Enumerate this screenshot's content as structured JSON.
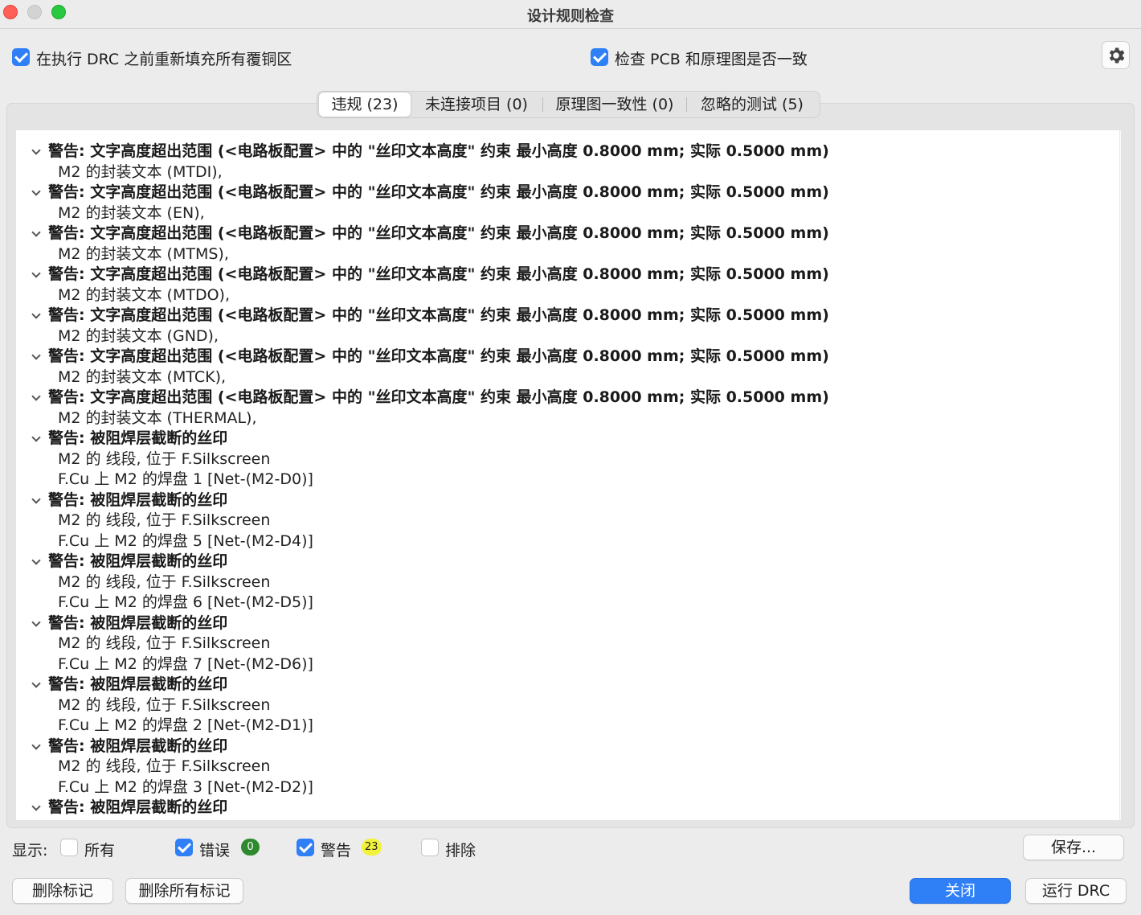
{
  "window": {
    "title": "设计规则检查"
  },
  "options": {
    "refill_zones": {
      "label": "在执行 DRC 之前重新填充所有覆铜区",
      "checked": true
    },
    "check_parity": {
      "label": "检查 PCB 和原理图是否一致",
      "checked": true
    }
  },
  "tabs": [
    {
      "label": "违规 (23)",
      "active": true
    },
    {
      "label": "未连接项目 (0)",
      "active": false
    },
    {
      "label": "原理图一致性 (0)",
      "active": false
    },
    {
      "label": "忽略的测试 (5)",
      "active": false
    }
  ],
  "violations": [
    {
      "title": "警告: 文字高度超出范围 (<电路板配置> 中的 \"丝印文本高度\" 约束 最小高度 0.8000 mm; 实际 0.5000 mm)",
      "items": [
        "M2 的封装文本 (MTDI),"
      ]
    },
    {
      "title": "警告: 文字高度超出范围 (<电路板配置> 中的 \"丝印文本高度\" 约束 最小高度 0.8000 mm; 实际 0.5000 mm)",
      "items": [
        "M2 的封装文本 (EN),"
      ]
    },
    {
      "title": "警告: 文字高度超出范围 (<电路板配置> 中的 \"丝印文本高度\" 约束 最小高度 0.8000 mm; 实际 0.5000 mm)",
      "items": [
        "M2 的封装文本 (MTMS),"
      ]
    },
    {
      "title": "警告: 文字高度超出范围 (<电路板配置> 中的 \"丝印文本高度\" 约束 最小高度 0.8000 mm; 实际 0.5000 mm)",
      "items": [
        "M2 的封装文本 (MTDO),"
      ]
    },
    {
      "title": "警告: 文字高度超出范围 (<电路板配置> 中的 \"丝印文本高度\" 约束 最小高度 0.8000 mm; 实际 0.5000 mm)",
      "items": [
        "M2 的封装文本 (GND),"
      ]
    },
    {
      "title": "警告: 文字高度超出范围 (<电路板配置> 中的 \"丝印文本高度\" 约束 最小高度 0.8000 mm; 实际 0.5000 mm)",
      "items": [
        "M2 的封装文本 (MTCK),"
      ]
    },
    {
      "title": "警告: 文字高度超出范围 (<电路板配置> 中的 \"丝印文本高度\" 约束 最小高度 0.8000 mm; 实际 0.5000 mm)",
      "items": [
        "M2 的封装文本 (THERMAL),"
      ]
    },
    {
      "title": "警告: 被阻焊层截断的丝印",
      "items": [
        "M2 的 线段, 位于 F.Silkscreen",
        "F.Cu 上 M2 的焊盘 1 [Net-(M2-D0)]"
      ]
    },
    {
      "title": "警告: 被阻焊层截断的丝印",
      "items": [
        "M2 的 线段, 位于 F.Silkscreen",
        "F.Cu 上 M2 的焊盘 5 [Net-(M2-D4)]"
      ]
    },
    {
      "title": "警告: 被阻焊层截断的丝印",
      "items": [
        "M2 的 线段, 位于 F.Silkscreen",
        "F.Cu 上 M2 的焊盘 6 [Net-(M2-D5)]"
      ]
    },
    {
      "title": "警告: 被阻焊层截断的丝印",
      "items": [
        "M2 的 线段, 位于 F.Silkscreen",
        "F.Cu 上 M2 的焊盘 7 [Net-(M2-D6)]"
      ]
    },
    {
      "title": "警告: 被阻焊层截断的丝印",
      "items": [
        "M2 的 线段, 位于 F.Silkscreen",
        "F.Cu 上 M2 的焊盘 2 [Net-(M2-D1)]"
      ]
    },
    {
      "title": "警告: 被阻焊层截断的丝印",
      "items": [
        "M2 的 线段, 位于 F.Silkscreen",
        "F.Cu 上 M2 的焊盘 3 [Net-(M2-D2)]"
      ]
    },
    {
      "title": "警告: 被阻焊层截断的丝印",
      "items": []
    }
  ],
  "filter": {
    "label": "显示:",
    "all": {
      "label": "所有",
      "checked": false
    },
    "errors": {
      "label": "错误",
      "checked": true,
      "count": "0",
      "color": "#2e8a2e"
    },
    "warnings": {
      "label": "警告",
      "checked": true,
      "count": "23",
      "color": "#f2f23a"
    },
    "exclusions": {
      "label": "排除",
      "checked": false
    }
  },
  "buttons": {
    "save": "保存...",
    "delete_marker": "删除标记",
    "delete_all_markers": "删除所有标记",
    "close": "关闭",
    "run_drc": "运行 DRC"
  }
}
